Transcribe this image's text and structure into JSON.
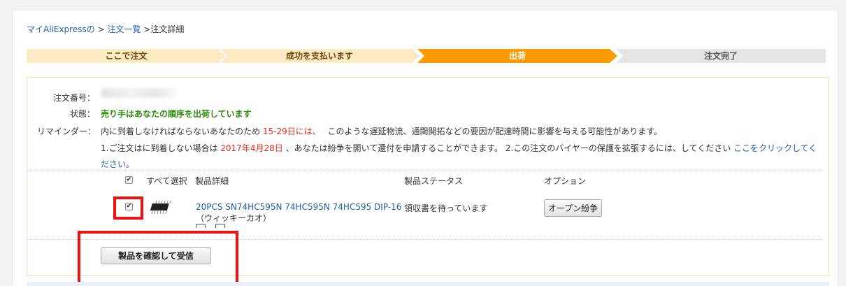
{
  "breadcrumb": {
    "my": "マイAliExpressの",
    "sep1": " > ",
    "list": "注文一覧",
    "sep2": " >",
    "current": "注文詳細"
  },
  "steps": [
    "ここで注文",
    "成功を支払います",
    "出荷",
    "注文完了"
  ],
  "colors": {
    "step_done": "#fde9c2",
    "step_active": "#ff9900",
    "step_todo": "#e5e5e5",
    "status": "#2f8a0e",
    "link": "#1f5ea8",
    "highlight": "#e52b1c"
  },
  "order": {
    "number_label": "注文番号：",
    "status_label": "状態：",
    "status_value": "売り手はあなたの順序を出荷しています",
    "reminder_label": "リマインダー：",
    "reminder1_pre": "内に到着しなければならないあなたのため",
    "reminder1_days": "15-29日には、",
    "reminder1_post": "このような遅延物流、通関開拓などの要因が配達時間に影響を与える可能性があります。",
    "reminder2_pre": "1.ご注文はに到着しない場合は",
    "reminder2_date": "2017年4月28日",
    "reminder2_mid": "、あなたは紛争を開いて還付を申請することができます。 2.この注文のバイヤーの保護を拡張するには、してください",
    "reminder2_link1": "ここをクリックしてく",
    "reminder2_link2": "ださい。"
  },
  "table": {
    "select_all": "すべて選択",
    "col_product": "製品詳細",
    "col_status": "製品ステータス",
    "col_options": "オプション",
    "rows": [
      {
        "title": "20PCS SN74HC595N 74HC595N 74HC595 DIP-16",
        "variant": "（ウィッキーカオ）",
        "status": "領収書を待っています",
        "action": "オープン紛争",
        "checked": true
      }
    ]
  },
  "confirm_button": "製品を確認して受信"
}
